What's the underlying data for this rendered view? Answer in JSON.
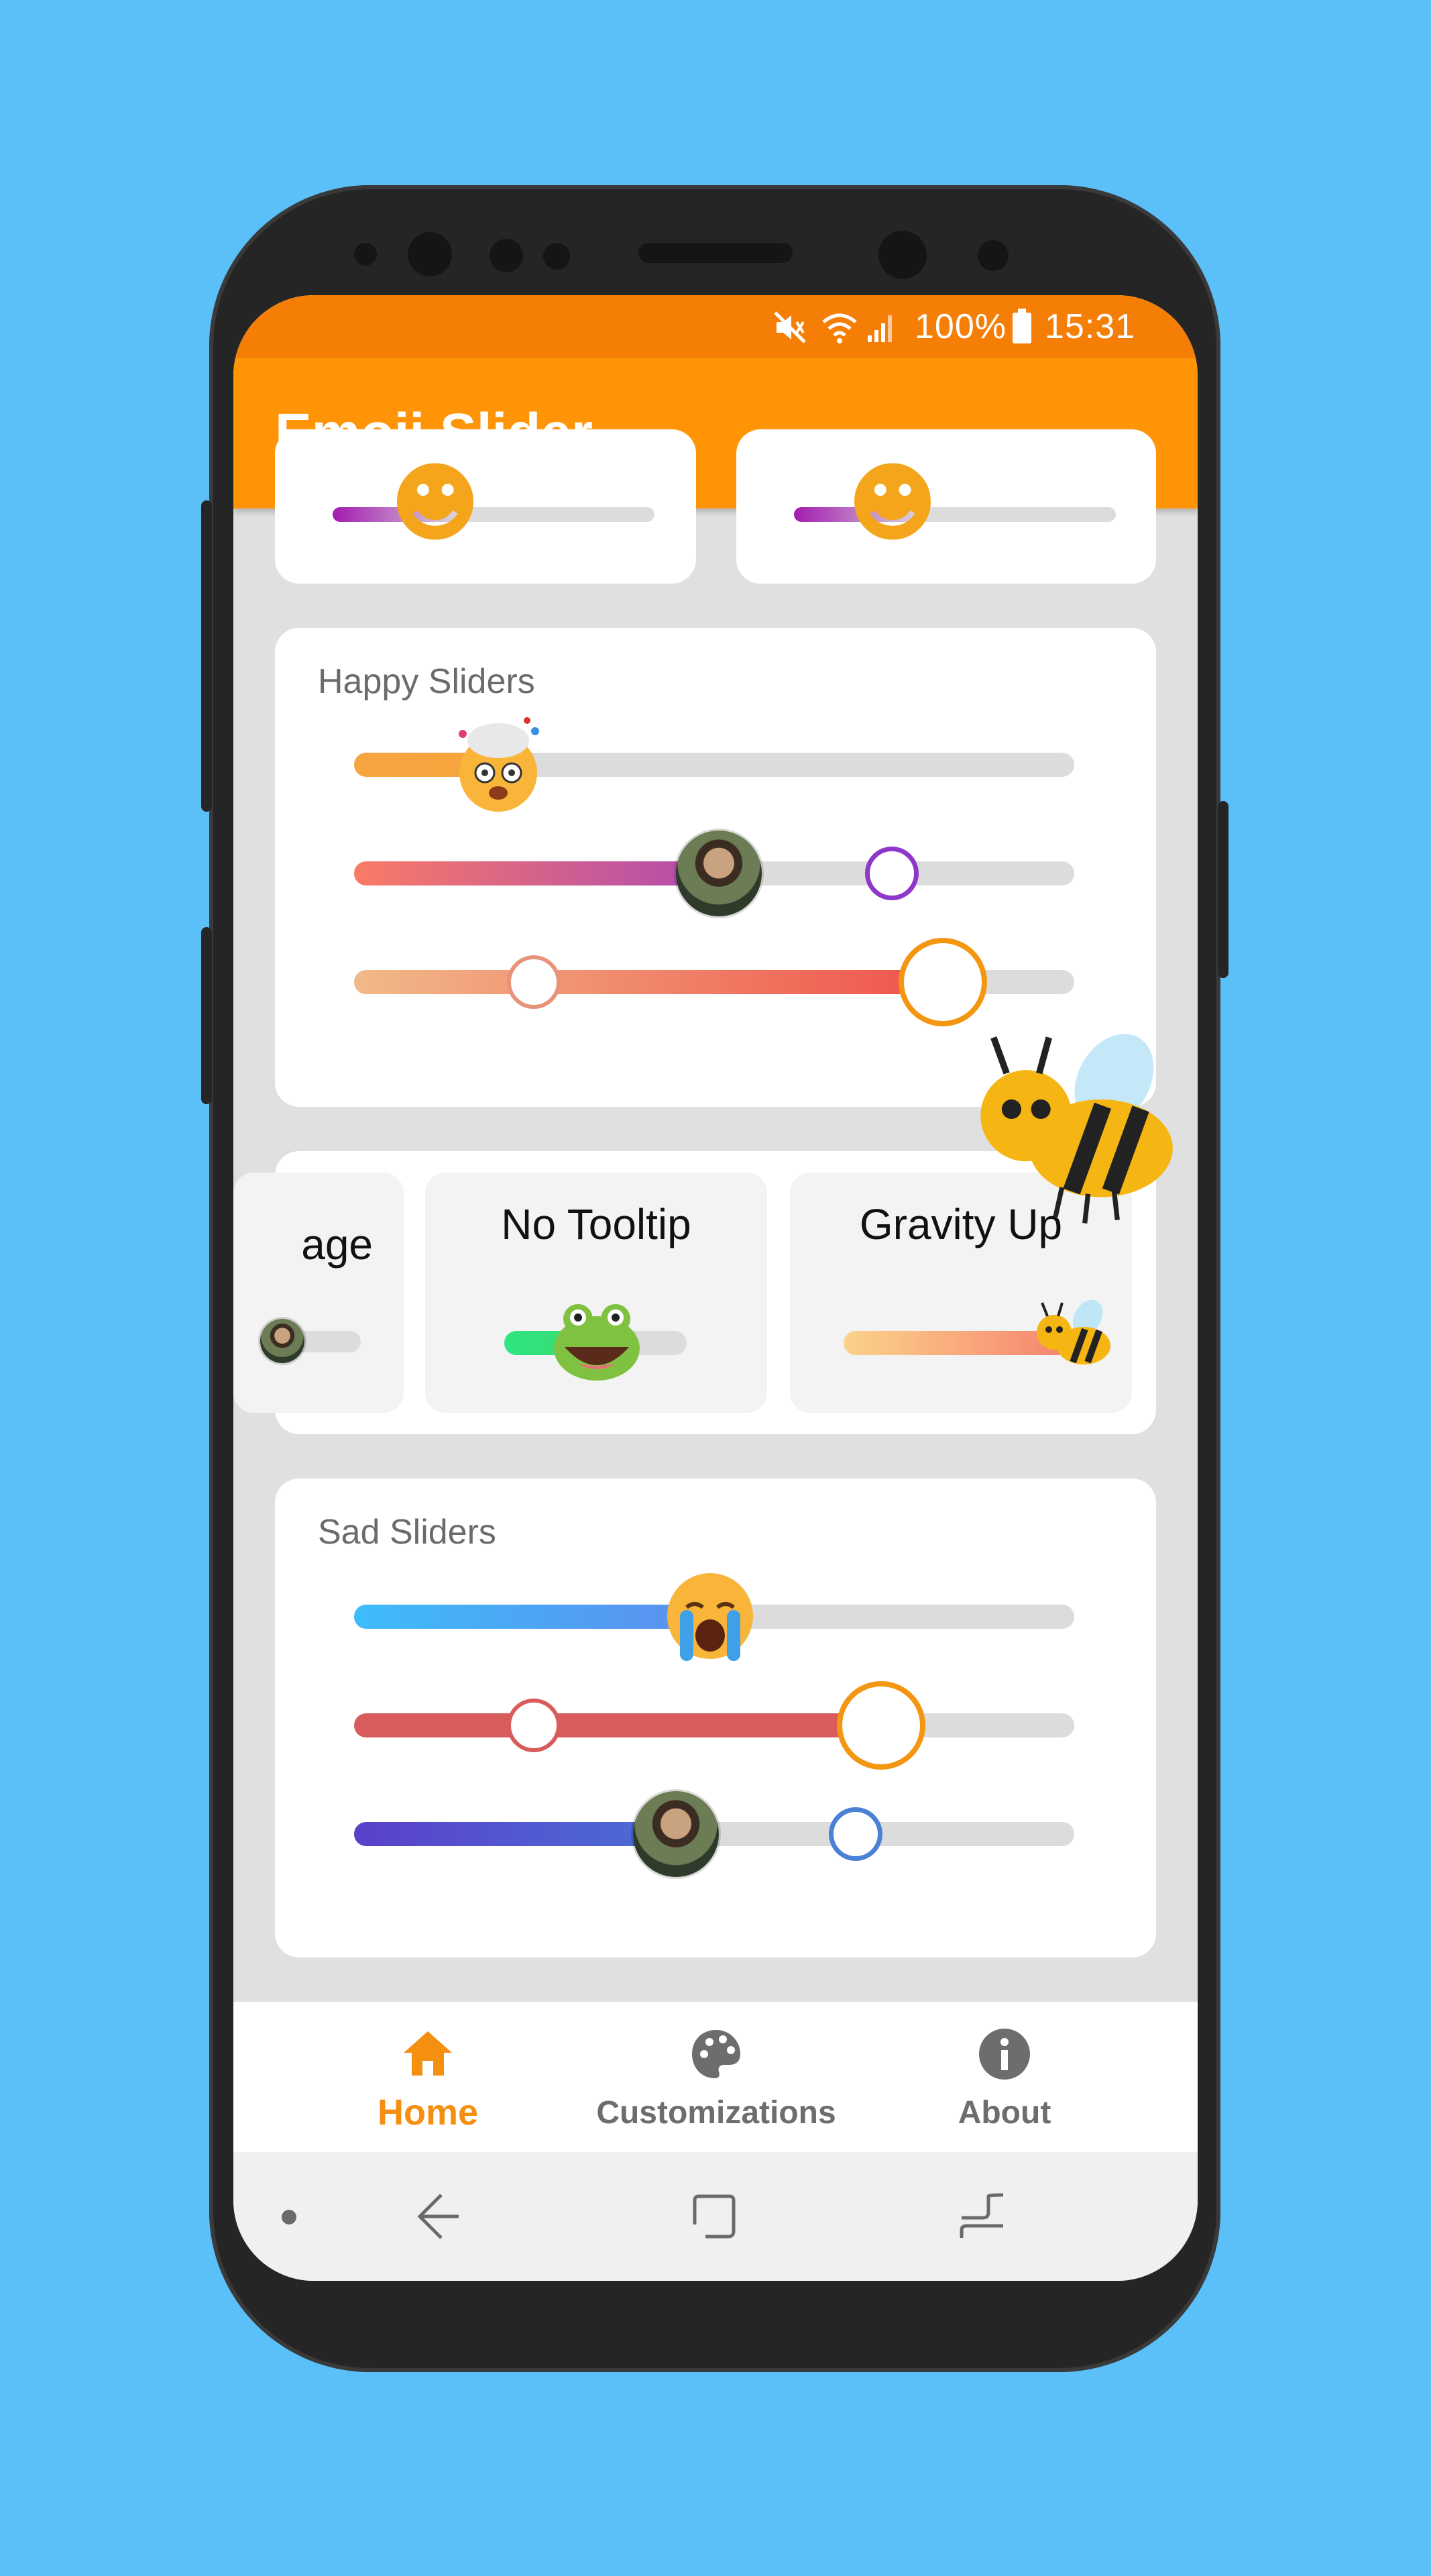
{
  "status_bar": {
    "battery": "100%",
    "time": "15:31",
    "icons": [
      "mute-icon",
      "wifi-icon",
      "signal-icon",
      "battery-icon"
    ]
  },
  "app": {
    "title": "Emoji Slider",
    "accent_color": "#ff9407",
    "status_color": "#f57f06",
    "background_color": "#5bbff8"
  },
  "happy_sliders": {
    "title": "Happy Sliders",
    "sliders": [
      {
        "type": "emoji",
        "thumb_icon": "exploding-head-emoji",
        "value": 0.2
      },
      {
        "type": "avatar",
        "thumb_icon": "avatar-photo",
        "value": 0.5,
        "marker": 0.75
      },
      {
        "type": "ring",
        "thumb_icon": "orange-ring",
        "value": 0.82,
        "marker": 0.25
      }
    ]
  },
  "options_row": {
    "cards": [
      {
        "label": "age",
        "icon": "image-thumb",
        "value": 0.0
      },
      {
        "label": "No Tooltip",
        "icon": "frog-emoji",
        "value": 0.5
      },
      {
        "label": "Gravity Up",
        "icon": "bee-emoji",
        "value": 1.0
      }
    ],
    "floating_icon": "bee-emoji"
  },
  "sad_sliders": {
    "title": "Sad Sliders",
    "sliders": [
      {
        "type": "emoji",
        "thumb_icon": "crying-face-emoji",
        "value": 0.5
      },
      {
        "type": "ring",
        "thumb_icon": "orange-ring",
        "value": 0.73,
        "marker": 0.25
      },
      {
        "type": "avatar",
        "thumb_icon": "avatar-photo",
        "value": 0.45,
        "marker": 0.7
      }
    ]
  },
  "bottom_nav": {
    "items": [
      {
        "label": "Home",
        "icon": "home-icon",
        "active": true
      },
      {
        "label": "Customizations",
        "icon": "palette-icon",
        "active": false
      },
      {
        "label": "About",
        "icon": "info-icon",
        "active": false
      }
    ]
  },
  "system_nav": {
    "buttons": [
      "dot-icon",
      "back-icon",
      "home-square-icon",
      "recents-icon"
    ]
  }
}
